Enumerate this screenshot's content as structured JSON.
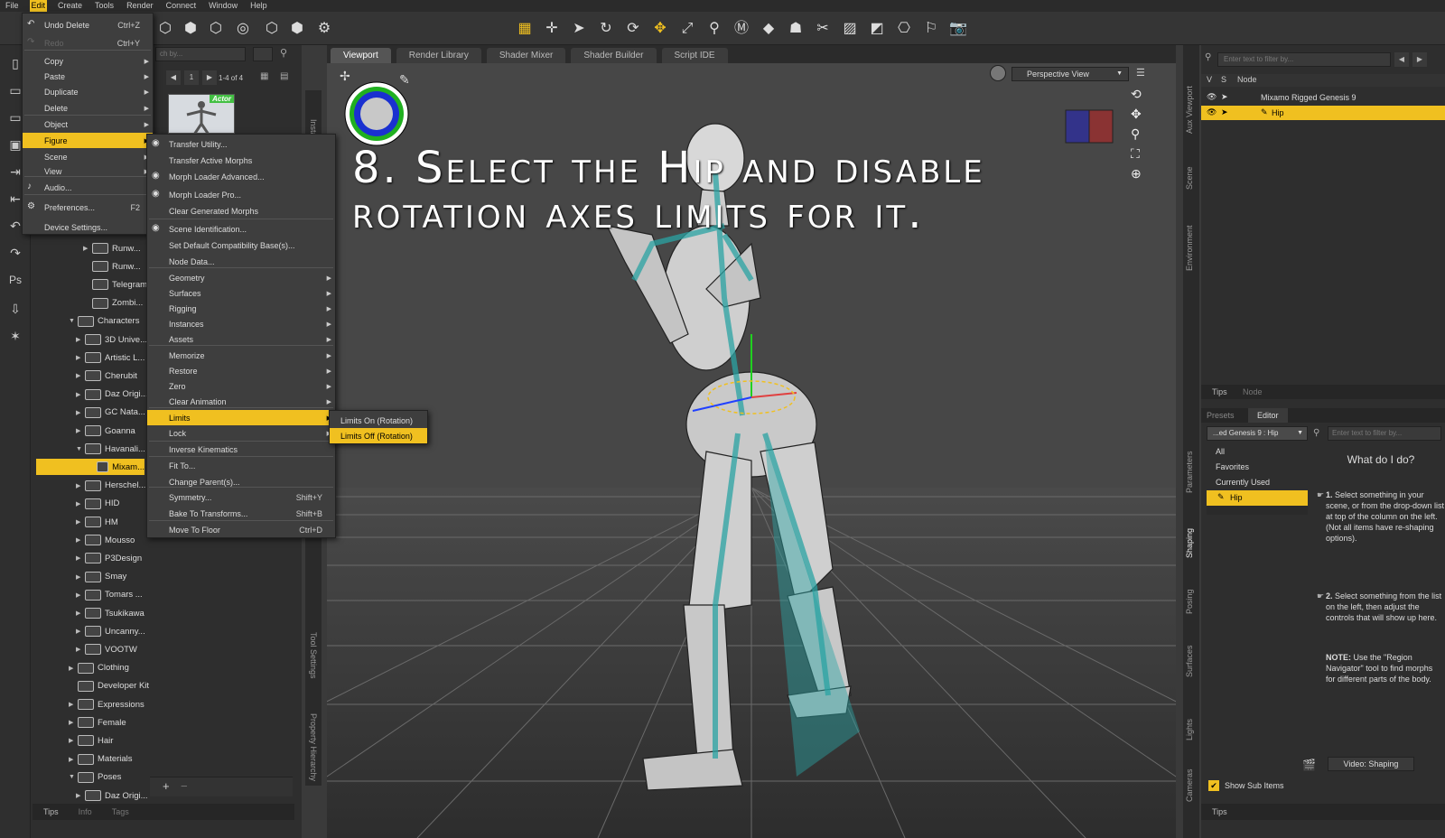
{
  "menubar": [
    "File",
    "Edit",
    "Create",
    "Tools",
    "Render",
    "Connect",
    "Window",
    "Help"
  ],
  "edit_menu": [
    {
      "label": "Undo Delete",
      "shortcut": "Ctrl+Z"
    },
    {
      "label": "Redo",
      "shortcut": "Ctrl+Y"
    },
    {
      "label": "Copy"
    },
    {
      "label": "Paste"
    },
    {
      "label": "Duplicate"
    },
    {
      "label": "Delete"
    },
    {
      "label": "Object"
    },
    {
      "label": "Figure"
    },
    {
      "label": "Scene"
    },
    {
      "label": "View"
    },
    {
      "label": "Audio..."
    },
    {
      "label": "Preferences...",
      "shortcut": "F2"
    },
    {
      "label": "Device Settings..."
    }
  ],
  "figure_menu": [
    {
      "label": "Transfer Utility..."
    },
    {
      "label": "Transfer Active Morphs"
    },
    {
      "label": "Morph Loader Advanced..."
    },
    {
      "label": "Morph Loader Pro..."
    },
    {
      "label": "Clear Generated Morphs"
    },
    {
      "label": "Scene Identification..."
    },
    {
      "label": "Set Default Compatibility Base(s)..."
    },
    {
      "label": "Node Data..."
    },
    {
      "label": "Geometry"
    },
    {
      "label": "Surfaces"
    },
    {
      "label": "Rigging"
    },
    {
      "label": "Instances"
    },
    {
      "label": "Assets"
    },
    {
      "label": "Memorize"
    },
    {
      "label": "Restore"
    },
    {
      "label": "Zero"
    },
    {
      "label": "Clear Animation"
    },
    {
      "label": "Limits"
    },
    {
      "label": "Lock"
    },
    {
      "label": "Inverse Kinematics"
    },
    {
      "label": "Fit To..."
    },
    {
      "label": "Change Parent(s)..."
    },
    {
      "label": "Symmetry...",
      "shortcut": "Shift+Y"
    },
    {
      "label": "Bake To Transforms...",
      "shortcut": "Shift+B"
    },
    {
      "label": "Move To Floor",
      "shortcut": "Ctrl+D"
    }
  ],
  "limits_menu": [
    {
      "label": "Limits On (Rotation)"
    },
    {
      "label": "Limits Off (Rotation)"
    }
  ],
  "content_tree": [
    "Runw...",
    "Runw...",
    "Telegram",
    "Zombi...",
    "Characters",
    "3D Unive...",
    "Artistic L...",
    "Cherubit",
    "Daz Origi...",
    "GC Nata...",
    "Goanna",
    "Havanali...",
    "Mixam...",
    "Herschel...",
    "HID",
    "HM",
    "Mousso",
    "P3Design",
    "Smay",
    "Tomars ...",
    "Tsukikawa",
    "Uncanny...",
    "VOOTW",
    "Clothing",
    "Developer Kit",
    "Expressions",
    "Female",
    "Hair",
    "Materials",
    "Poses",
    "Daz Origi..."
  ],
  "content_top": {
    "search_placeholder": "ch by...",
    "page": "1",
    "range": "1-4 of 4",
    "actor_badge": "Actor"
  },
  "left_bottom_tabs": [
    "Tips",
    "Info",
    "Tags"
  ],
  "left_vtabs": [
    "Install",
    "Tool Settings",
    "Property Hierarchy"
  ],
  "viewport_tabs": [
    "Viewport",
    "Render Library",
    "Shader Mixer",
    "Shader Builder",
    "Script IDE"
  ],
  "viewport": {
    "view_mode": "Perspective View"
  },
  "caption": {
    "line1": "8. Select the Hip and disable",
    "line2": "rotation axes limits for it."
  },
  "scene_panel": {
    "filter_placeholder": "Enter text to filter by...",
    "col_v": "V",
    "col_s": "S",
    "col_node": "Node",
    "root": "Mixamo Rigged Genesis 9",
    "child": "Hip",
    "tabs": [
      "Tips",
      "Node"
    ]
  },
  "params_panel": {
    "tabs": [
      "Presets",
      "Editor"
    ],
    "node_selector": "...ed Genesis 9 : Hip",
    "filter_placeholder": "Enter text to filter by...",
    "list": [
      "All",
      "Favorites",
      "Currently Used",
      "Hip"
    ],
    "help_title": "What do I do?",
    "step1_num": "1.",
    "step1": "Select something in your scene, or from the drop-down list at top of the column on the left. (Not all items have re-shaping options).",
    "step2_num": "2.",
    "step2": "Select something from the list on the left, then adjust the controls that will show up here.",
    "note_label": "NOTE:",
    "note": "Use the \"Region Navigator\" tool to find morphs for different parts of the body.",
    "video_button": "Video: Shaping",
    "show_sub": "Show Sub Items",
    "bottom_tab": "Tips"
  },
  "right_vtabs": [
    "Aux Viewport",
    "Scene",
    "Environment",
    "Parameters",
    "Shaping",
    "Posing",
    "Surfaces",
    "Lights",
    "Cameras"
  ],
  "colors": {
    "accent": "#f0c020",
    "teal": "#2aa3a3"
  }
}
